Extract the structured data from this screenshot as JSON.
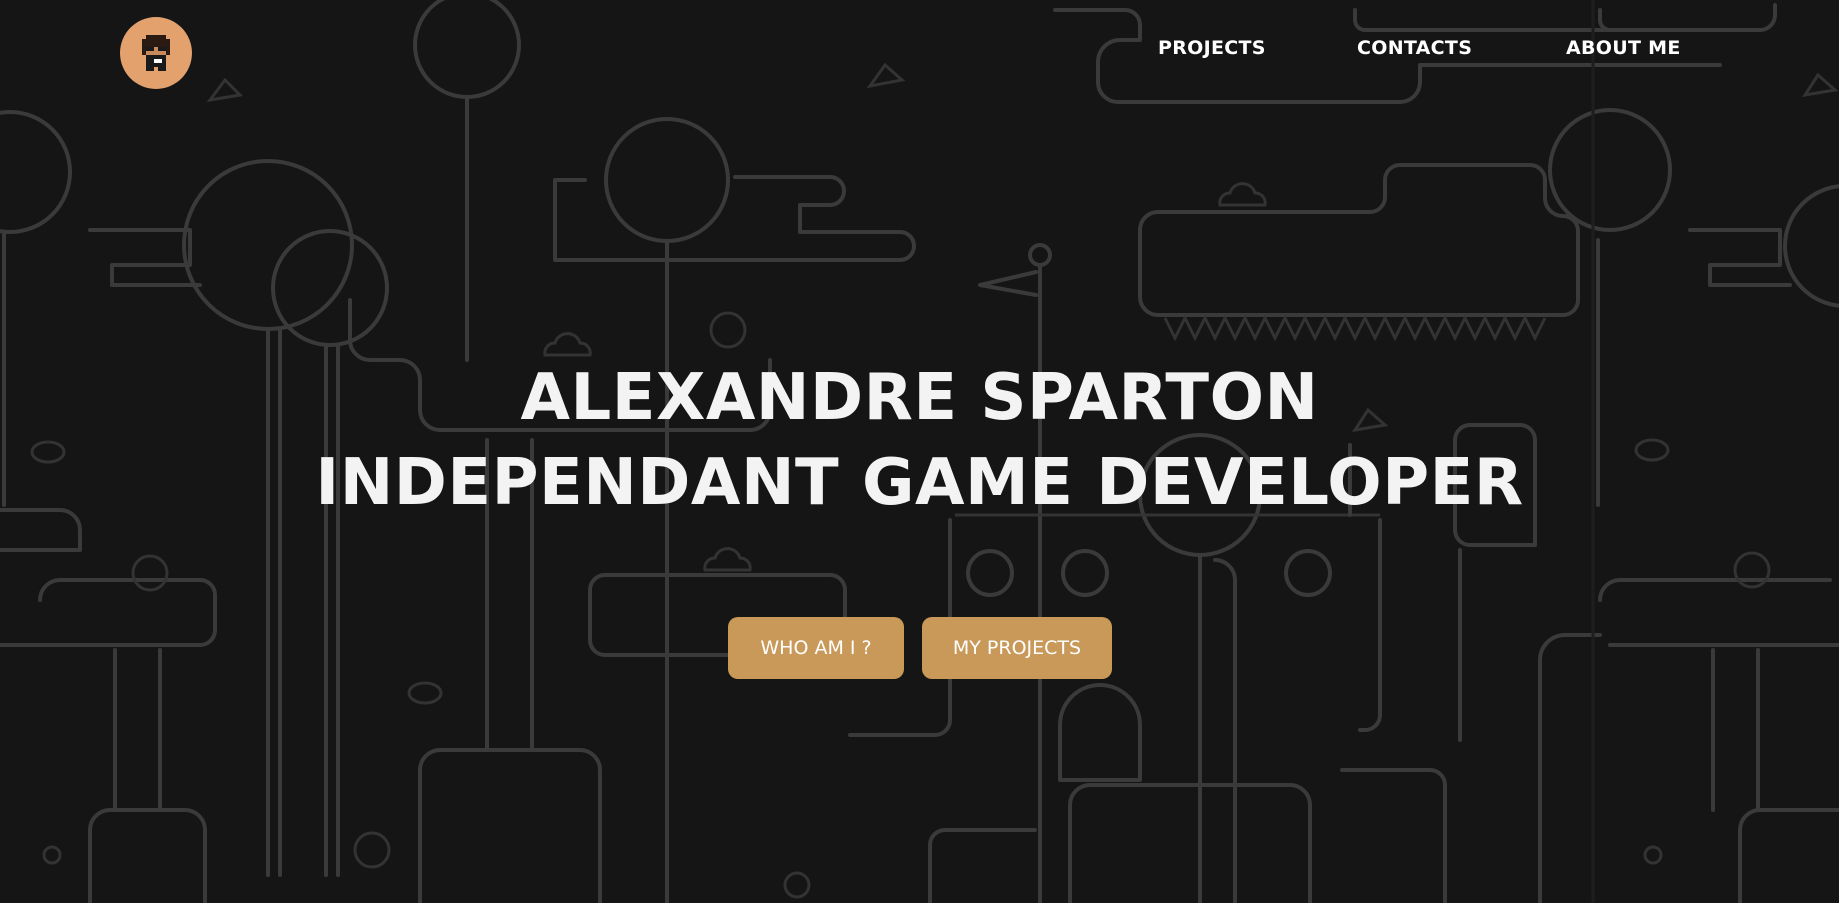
{
  "nav": {
    "logo_alt": "pixel-avatar",
    "links": [
      {
        "label": "PROJECTS"
      },
      {
        "label": "CONTACTS"
      },
      {
        "label": "ABOUT ME"
      }
    ]
  },
  "hero": {
    "name": "ALEXANDRE SPARTON",
    "subtitle": "INDEPENDANT GAME DEVELOPER"
  },
  "buttons": {
    "who_am_i": "WHO AM I ?",
    "my_projects": "MY PROJECTS"
  },
  "colors": {
    "background": "#151515",
    "pattern_line": "#3a3a3a",
    "accent": "#c9995a",
    "logo_bg": "#e3a16e",
    "text": "#f3f3f3"
  }
}
